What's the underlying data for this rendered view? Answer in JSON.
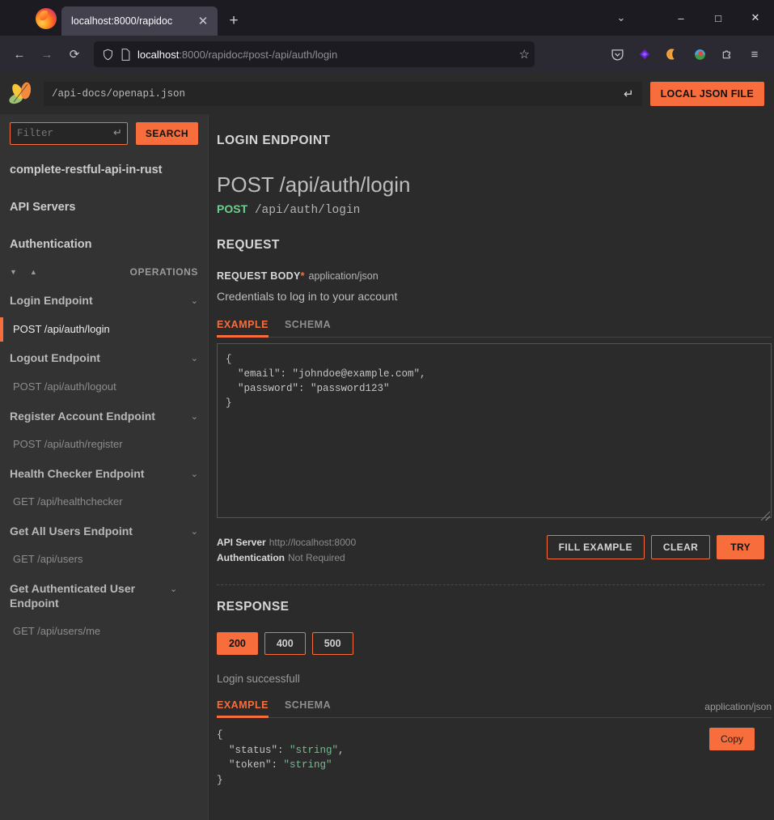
{
  "browser": {
    "tab_title": "localhost:8000/rapidoc",
    "url_host": "localhost",
    "url_rest": ":8000/rapidoc#post-/api/auth/login",
    "new_tab_label": "+",
    "close_tab_label": "✕",
    "back_label": "←",
    "forward_label": "→",
    "reload_label": "⟳",
    "list_all_tabs_label": "⌄",
    "minimize_label": "–",
    "maximize_label": "□",
    "close_label": "✕",
    "bookmark_label": "☆",
    "menu_label": "≡"
  },
  "header": {
    "spec_url": "/api-docs/openapi.json",
    "spec_enter_glyph": "↵",
    "local_json_label": "LOCAL JSON FILE"
  },
  "sidebar": {
    "filter_placeholder": "Filter",
    "filter_value": "",
    "filter_enter_glyph": "↵",
    "search_label": "SEARCH",
    "sections": [
      "complete-restful-api-in-rust",
      "API Servers",
      "Authentication"
    ],
    "sort_desc_glyph": "▼",
    "sort_asc_glyph": "▲",
    "operations_label": "OPERATIONS",
    "chevron_glyph": "⌄",
    "groups": [
      {
        "tag": "Login Endpoint",
        "path": "POST /api/auth/login",
        "active": true
      },
      {
        "tag": "Logout Endpoint",
        "path": "POST /api/auth/logout",
        "active": false
      },
      {
        "tag": "Register Account Endpoint",
        "path": "POST /api/auth/register",
        "active": false
      },
      {
        "tag": "Health Checker Endpoint",
        "path": "GET /api/healthchecker",
        "active": false
      },
      {
        "tag": "Get All Users Endpoint",
        "path": "GET /api/users",
        "active": false
      },
      {
        "tag": "Get Authenticated User Endpoint",
        "path": "GET /api/users/me",
        "active": false
      }
    ]
  },
  "main": {
    "tag_title": "LOGIN ENDPOINT",
    "summary": "POST /api/auth/login",
    "method": "POST",
    "path": "/api/auth/login",
    "request_title": "REQUEST",
    "request_body_label": "REQUEST BODY",
    "request_body_required_marker": "*",
    "request_body_mime": "application/json",
    "request_description": "Credentials to log in to your account",
    "tab_example": "EXAMPLE",
    "tab_schema": "SCHEMA",
    "request_example": "{\n  \"email\": \"johndoe@example.com\",\n  \"password\": \"password123\"\n}",
    "api_server_label": "API Server",
    "api_server_value": "http://localhost:8000",
    "auth_label": "Authentication",
    "auth_value": "Not Required",
    "fill_example_label": "FILL EXAMPLE",
    "clear_label": "CLEAR",
    "try_label": "TRY"
  },
  "response": {
    "title": "RESPONSE",
    "codes": [
      {
        "code": "200",
        "selected": true
      },
      {
        "code": "400",
        "selected": false
      },
      {
        "code": "500",
        "selected": false
      }
    ],
    "description": "Login successfull",
    "tab_example": "EXAMPLE",
    "tab_schema": "SCHEMA",
    "mime": "application/json",
    "copy_label": "Copy",
    "json_lines": [
      {
        "plain": "{",
        "key": "",
        "val": "",
        "tail": ""
      },
      {
        "plain": "",
        "key": "  \"status\": ",
        "val": "\"string\"",
        "tail": ","
      },
      {
        "plain": "",
        "key": "  \"token\": ",
        "val": "\"string\"",
        "tail": ""
      },
      {
        "plain": "}",
        "key": "",
        "val": "",
        "tail": ""
      }
    ]
  },
  "colors": {
    "accent": "#f76e3c",
    "bg": "#2b2b2b",
    "sidebar_bg": "#333333",
    "method_post": "#6fcf8e",
    "string": "#6fbf8e"
  }
}
